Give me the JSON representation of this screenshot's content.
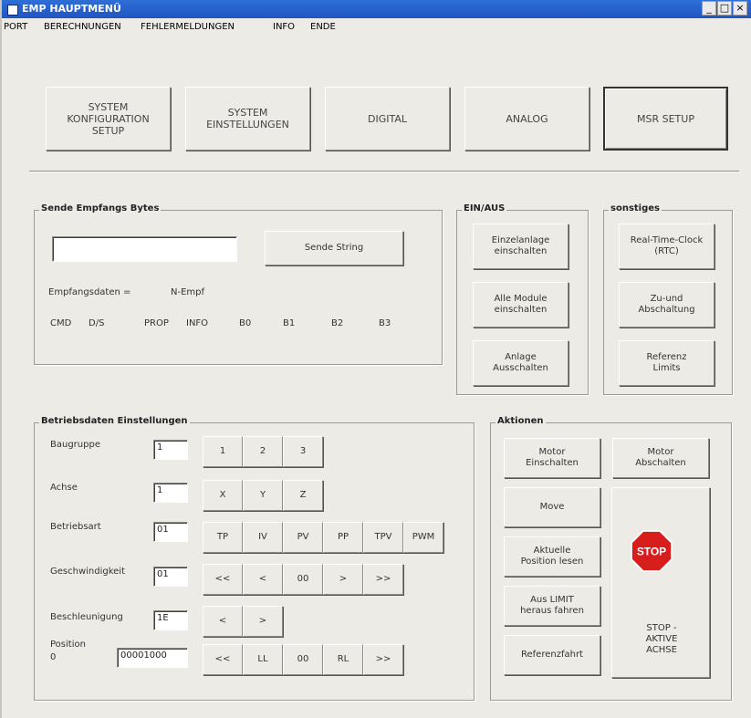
{
  "window": {
    "title": "EMP HAUPTMENÜ",
    "controls": [
      "_",
      "□",
      "×"
    ]
  },
  "menu": [
    "PORT",
    "BERECHNUNGEN",
    "FEHLERMELDUNGEN",
    "INFO",
    "ENDE"
  ],
  "top_buttons": [
    "SYSTEM\nKONFIGURATION\nSETUP",
    "SYSTEM\nEINSTELLUNGEN",
    "DIGITAL",
    "ANALOG",
    "MSR SETUP"
  ],
  "send": {
    "legend": "Sende Empfangs Bytes",
    "input_value": "",
    "send_label": "Sende String",
    "recv_label": "Empfangsdaten =",
    "recv_value": "N-Empf",
    "columns": [
      "CMD",
      "D/S",
      "PROP",
      "INFO",
      "B0",
      "B1",
      "B2",
      "B3"
    ]
  },
  "einaus": {
    "legend": "EIN/AUS",
    "buttons": [
      "Einzelanlage\neinschalten",
      "Alle Module\neinschalten",
      "Anlage\nAusschalten"
    ]
  },
  "sonst": {
    "legend": "sonstiges",
    "buttons": [
      "Real-Time-Clock\n(RTC)",
      "Zu-und\nAbschaltung",
      "Referenz\nLimits"
    ]
  },
  "betrieb": {
    "legend": "Betriebsdaten Einstellungen",
    "rows": [
      {
        "label": "Baugruppe",
        "value": "1",
        "buttons": [
          "1",
          "2",
          "3"
        ]
      },
      {
        "label": "Achse",
        "value": "1",
        "buttons": [
          "X",
          "Y",
          "Z"
        ]
      },
      {
        "label": "Betriebsart",
        "value": "01",
        "buttons": [
          "TP",
          "IV",
          "PV",
          "PP",
          "TPV",
          "PWM"
        ]
      },
      {
        "label": "Geschwindigkeit",
        "value": "01",
        "buttons": [
          "<<",
          "<",
          "00",
          ">",
          ">>"
        ]
      },
      {
        "label": "Beschleunigung",
        "value": "1E",
        "buttons": [
          "<",
          ">"
        ]
      },
      {
        "label": "Position\n0",
        "value": "00001000",
        "buttons": [
          "<<",
          "LL",
          "00",
          "RL",
          ">>"
        ]
      }
    ]
  },
  "aktionen": {
    "legend": "Aktionen",
    "motor_ein": "Motor\nEinschalten",
    "motor_aus": "Motor\nAbschalten",
    "move": "Move",
    "aktuelle_pos": "Aktuelle\nPosition lesen",
    "limit": "Aus LIMIT\nheraus fahren",
    "referenzfahrt": "Referenzfahrt",
    "stop_sign": "STOP",
    "stop_label": "STOP -\nAKTIVE\nACHSE"
  },
  "colors": {
    "title_bar": "#2f6fd6",
    "stop_red": "#d81d1d"
  }
}
